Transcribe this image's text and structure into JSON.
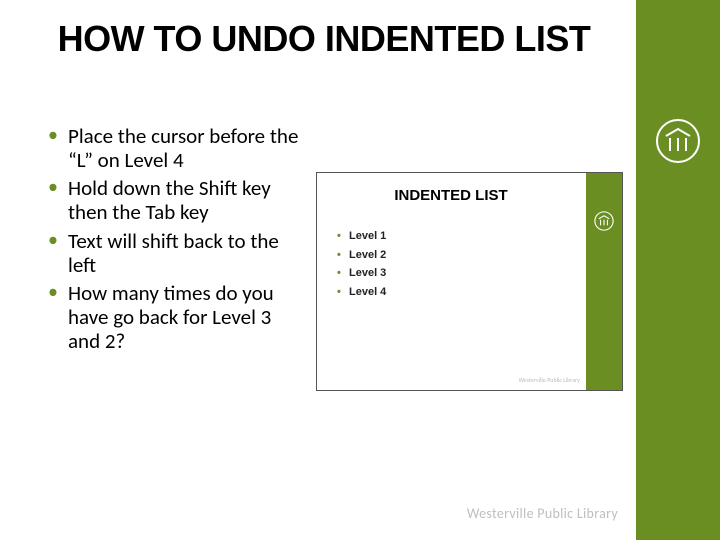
{
  "title": "HOW TO UNDO INDENTED LIST",
  "bullets": [
    "Place the cursor before the “L” on Level 4",
    "Hold down the Shift key then the Tab key",
    "Text will shift back to the left",
    "How many times do you have go back for Level 3 and 2?"
  ],
  "inset": {
    "title": "INDENTED LIST",
    "items": [
      "Level 1",
      "Level 2",
      "Level 3",
      "Level 4"
    ],
    "footer": "Westerville Public Library"
  },
  "footer": "Westerville Public Library",
  "accent": "#6b8e23"
}
